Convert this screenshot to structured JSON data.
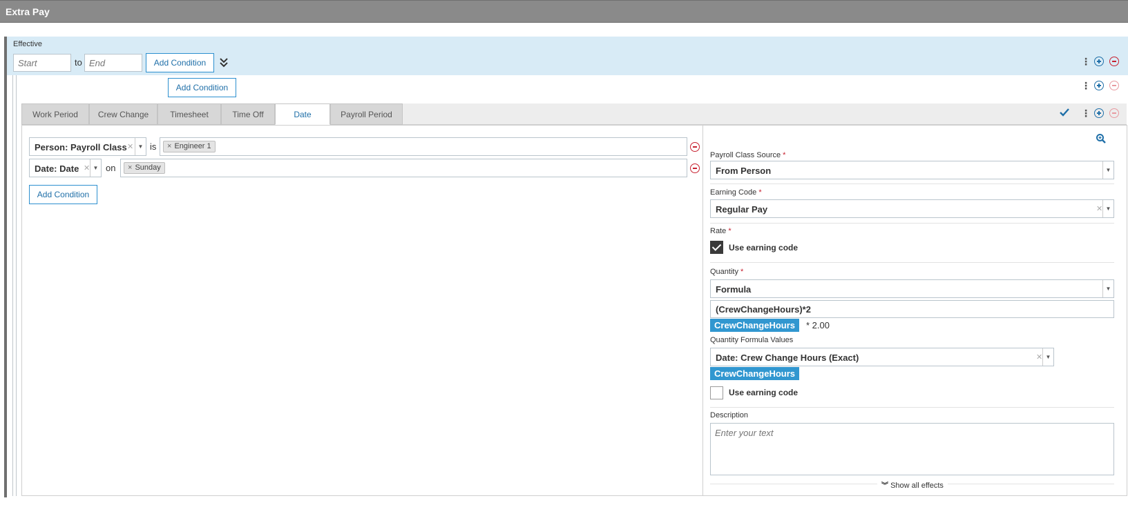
{
  "title": "Extra Pay",
  "effective": {
    "label": "Effective",
    "start_placeholder": "Start",
    "to_label": "to",
    "end_placeholder": "End",
    "add_condition_label": "Add Condition"
  },
  "group": {
    "add_condition_label": "Add Condition"
  },
  "tabs": [
    "Work Period",
    "Crew Change",
    "Timesheet",
    "Time Off",
    "Date",
    "Payroll Period"
  ],
  "active_tab": "Date",
  "conditions": [
    {
      "field": "Person: Payroll Class",
      "operator": "is",
      "value": "Engineer 1"
    },
    {
      "field": "Date: Date",
      "operator": "on",
      "value": "Sunday"
    }
  ],
  "conditions_add_label": "Add Condition",
  "effect": {
    "payroll_class_source": {
      "label": "Payroll Class Source",
      "value": "From Person"
    },
    "earning_code": {
      "label": "Earning Code",
      "value": "Regular Pay"
    },
    "rate": {
      "label": "Rate",
      "use_earning_code_label": "Use earning code",
      "checked": true
    },
    "quantity": {
      "label": "Quantity",
      "type": "Formula",
      "formula": "(CrewChangeHours)*2",
      "preview_chip": "CrewChangeHours",
      "preview_rest": "* 2.00"
    },
    "quantity_formula_values": {
      "label": "Quantity Formula Values",
      "value": "Date: Crew Change Hours (Exact)",
      "chip": "CrewChangeHours",
      "use_earning_code_label": "Use earning code",
      "checked": false
    },
    "description": {
      "label": "Description",
      "placeholder": "Enter your text"
    },
    "show_all_effects_label": "Show all effects"
  },
  "colors": {
    "titlebar": "#8a8a8a",
    "effective_bg": "#d8ebf6",
    "accent": "#1f6fa8",
    "remove": "#c7202f",
    "chip": "#3197d0"
  }
}
